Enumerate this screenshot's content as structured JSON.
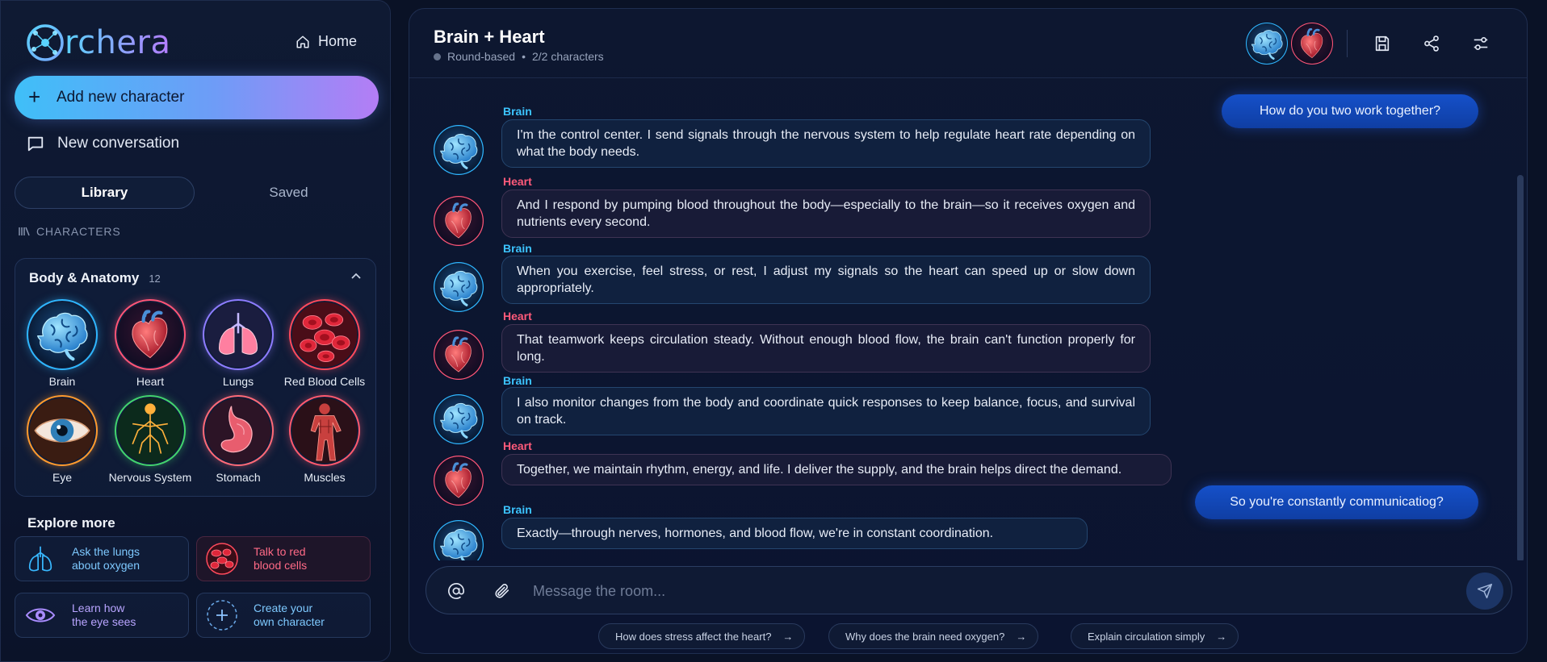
{
  "app": {
    "logo_text": "rchera",
    "home_label": "Home"
  },
  "sidebar": {
    "add_label": "Add new character",
    "new_conversation_label": "New conversation",
    "tabs": [
      {
        "label": "Library",
        "active": true
      },
      {
        "label": "Saved",
        "active": false
      }
    ],
    "section_label": "CHARACTERS",
    "category": {
      "title": "Body & Anatomy",
      "count": "12",
      "characters": [
        {
          "name": "Brain",
          "ring": "#2fb6ff",
          "icon": "brain-icon"
        },
        {
          "name": "Heart",
          "ring": "#ff5577",
          "icon": "heart-icon"
        },
        {
          "name": "Lungs",
          "ring": "#8d7cff",
          "icon": "lungs-icon"
        },
        {
          "name": "Red Blood Cells",
          "ring": "#ff4a5c",
          "icon": "blood-cells-icon"
        },
        {
          "name": "Eye",
          "ring": "#ff9a2e",
          "icon": "eye-icon"
        },
        {
          "name": "Nervous System",
          "ring": "#42d36e",
          "icon": "nervous-system-icon"
        },
        {
          "name": "Stomach",
          "ring": "#ff6a78",
          "icon": "stomach-icon"
        },
        {
          "name": "Muscles",
          "ring": "#ff5a6e",
          "icon": "muscles-icon"
        }
      ]
    },
    "explore": {
      "title": "Explore more",
      "cards": [
        {
          "line1": "Ask the lungs",
          "line2": "about oxygen"
        },
        {
          "line1": "Talk to red",
          "line2": "blood cells"
        },
        {
          "line1": "Learn how",
          "line2": "the eye sees"
        },
        {
          "line1": "Create your",
          "line2": "own character"
        }
      ]
    }
  },
  "room": {
    "title": "Brain + Heart",
    "mode": "Round-based",
    "characters_count": "2/2 characters"
  },
  "messages": [
    {
      "role": "user",
      "text": "How do you two work together?"
    },
    {
      "role": "bot",
      "speaker": "Brain",
      "text": "I'm the control center.  I send signals through the nervous system to help regulate heart rate depending on what the body needs."
    },
    {
      "role": "bot",
      "speaker": "Heart",
      "text": "And I respond by pumping blood throughout the body—especially to the brain—so it receives oxygen and nutrients every second."
    },
    {
      "role": "bot",
      "speaker": "Brain",
      "text": "When you exercise, feel stress, or rest, I adjust my signals so the heart can speed up or slow down appropriately."
    },
    {
      "role": "bot",
      "speaker": "Heart",
      "text": "That teamwork keeps circulation steady. Without enough blood flow, the brain can't function properly for long."
    },
    {
      "role": "bot",
      "speaker": "Brain",
      "text": "I also monitor changes from the body and coordinate quick responses to keep balance, focus, and survival on track."
    },
    {
      "role": "bot",
      "speaker": "Heart",
      "text": "Together, we maintain rhythm, energy, and life. I deliver the supply, and the brain helps direct the demand."
    },
    {
      "role": "user",
      "text": "So you're constantly communicatiog?"
    },
    {
      "role": "bot",
      "speaker": "Brain",
      "text": "Exactly—through nerves, hormones, and blood flow, we're in constant coordination."
    }
  ],
  "composer": {
    "placeholder": "Message the room..."
  },
  "suggestions": [
    "How does stress affect the heart?",
    "Why does the brain need oxygen?",
    "Explain circulation simply"
  ],
  "colors": {
    "brain_name": "#3cc4ff",
    "heart_name": "#ff5a7a",
    "user_bubble": "#1550c9",
    "accent_gradient_start": "#3fbff8",
    "accent_gradient_end": "#b47df5"
  }
}
